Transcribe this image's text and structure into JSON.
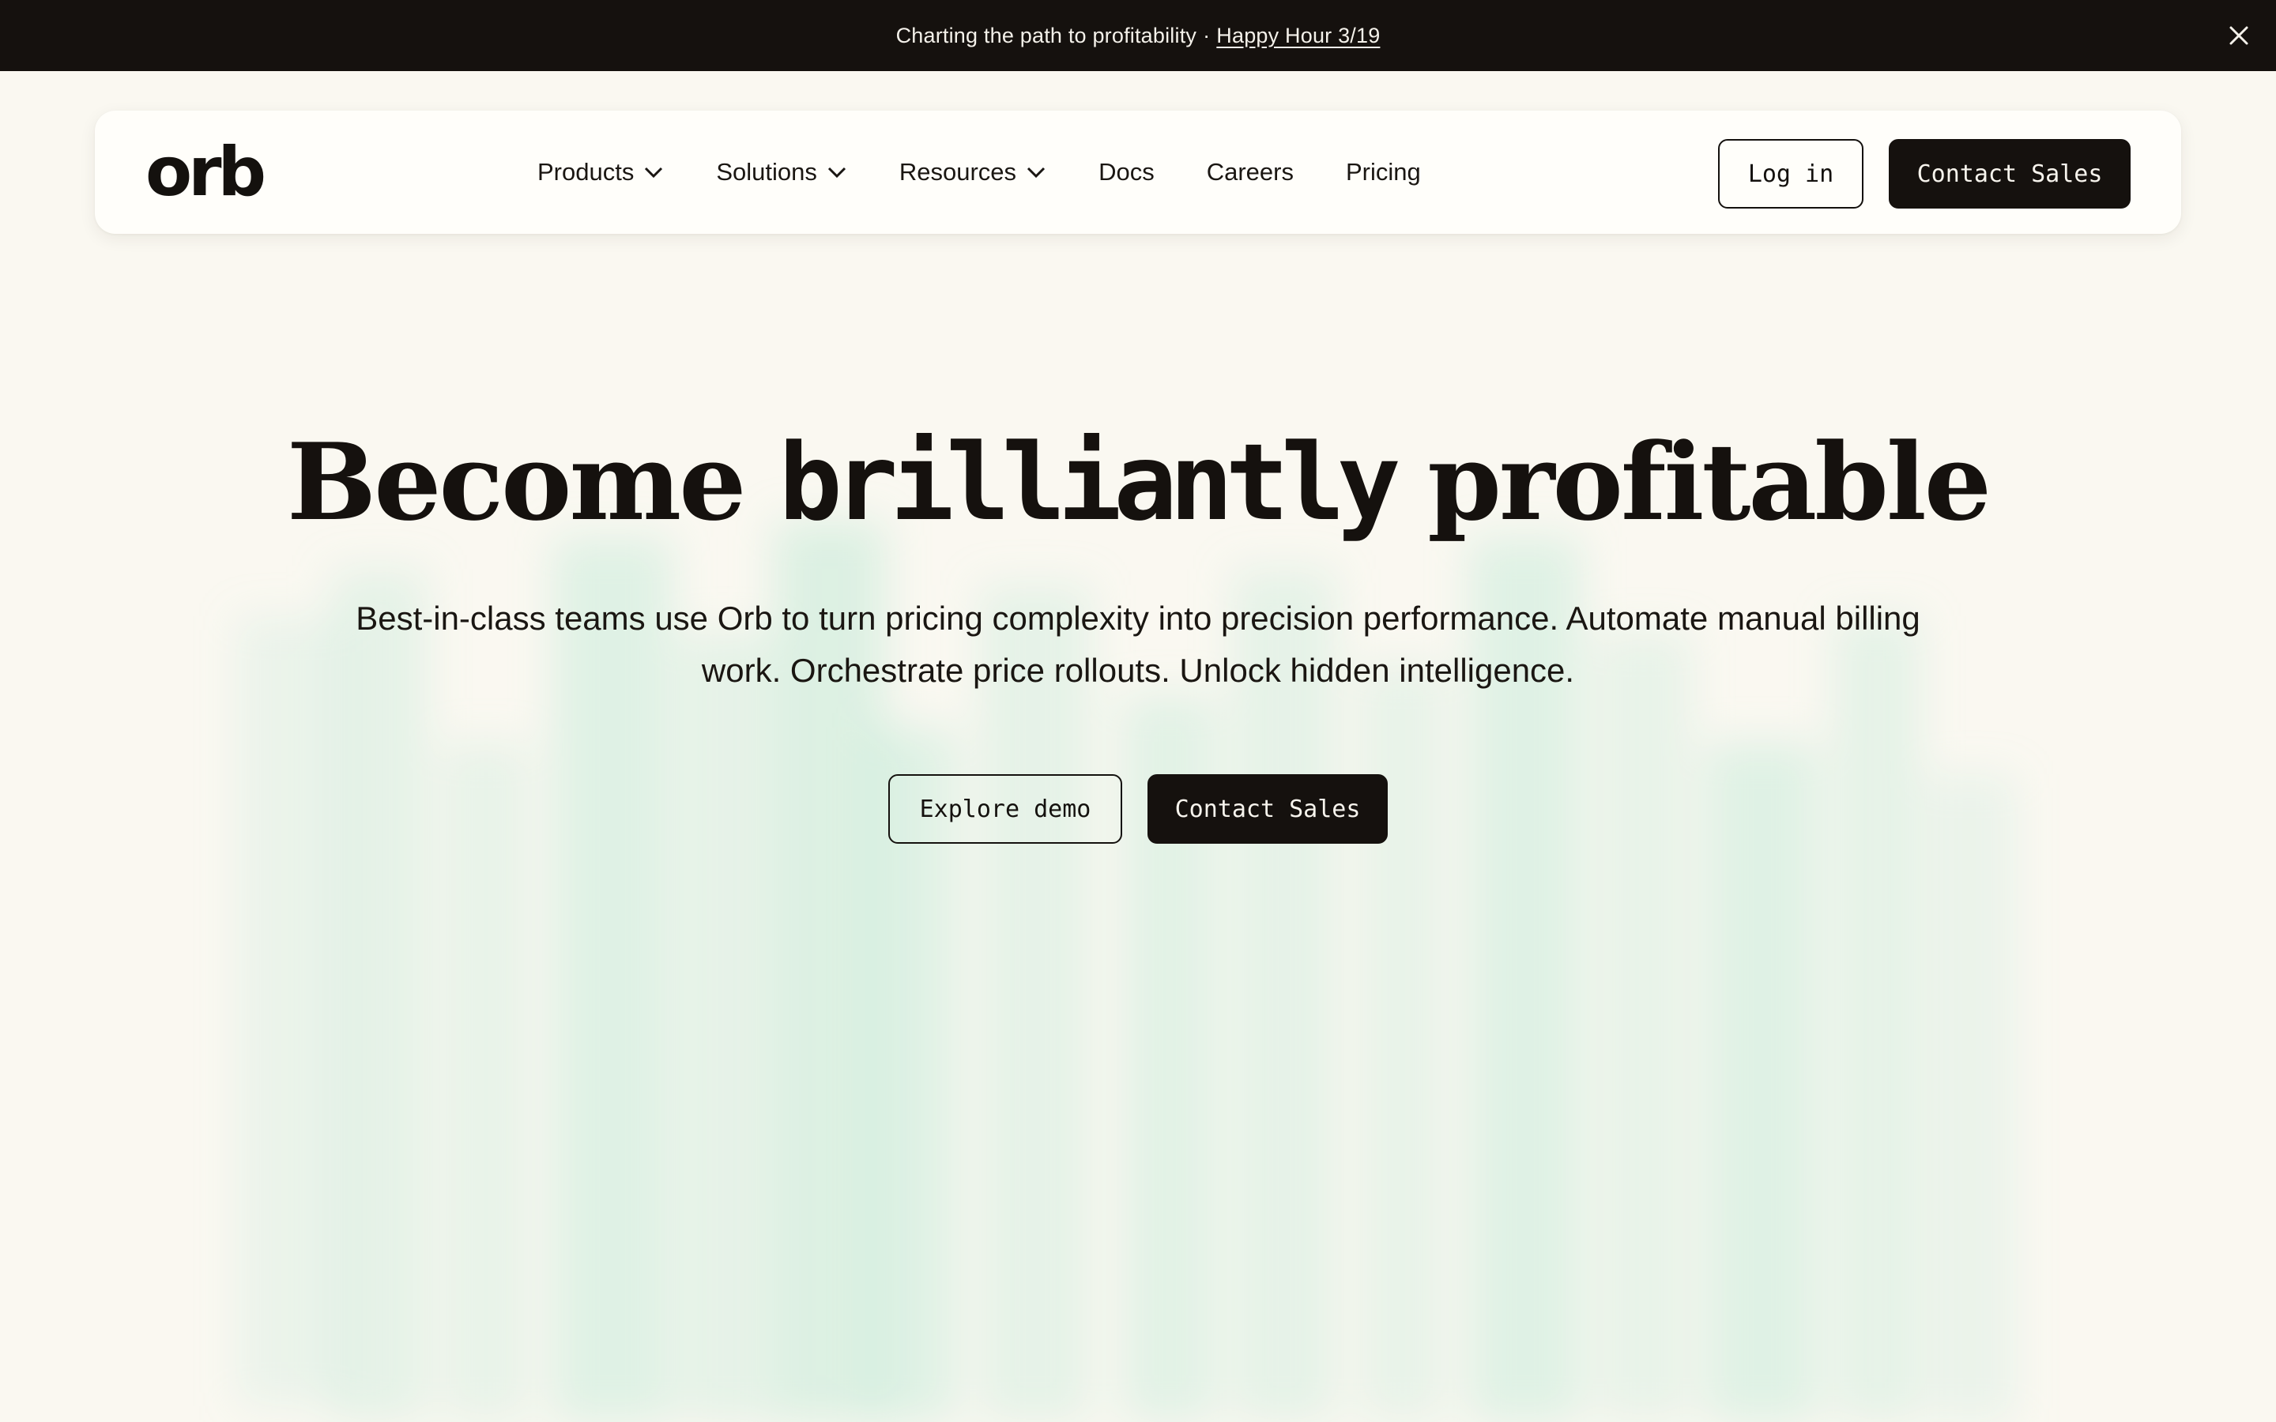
{
  "announcement": {
    "text": "Charting the path to profitability",
    "separator": "·",
    "link": "Happy Hour 3/19",
    "close_icon": "close-icon"
  },
  "nav": {
    "logo": "orb",
    "items": [
      {
        "label": "Products",
        "icon": "chevron-down-icon"
      },
      {
        "label": "Solutions",
        "icon": "chevron-down-icon"
      },
      {
        "label": "Resources",
        "icon": "chevron-down-icon"
      },
      {
        "label": "Docs"
      },
      {
        "label": "Careers"
      },
      {
        "label": "Pricing"
      }
    ],
    "login_label": "Log in",
    "contact_label": "Contact Sales"
  },
  "hero": {
    "title_part1": "Become",
    "title_highlight": "brilliantly",
    "title_part2": "profitable",
    "subtitle": "Best-in-class teams use Orb to turn pricing complexity into precision performance. Automate manual billing work. Orchestrate price rollouts. Unlock hidden intelligence.",
    "demo_label": "Explore demo",
    "contact_label": "Contact Sales"
  },
  "colors": {
    "background": "#faf8f1",
    "ink": "#15110e",
    "accent_mint": "#bfe9d6"
  }
}
